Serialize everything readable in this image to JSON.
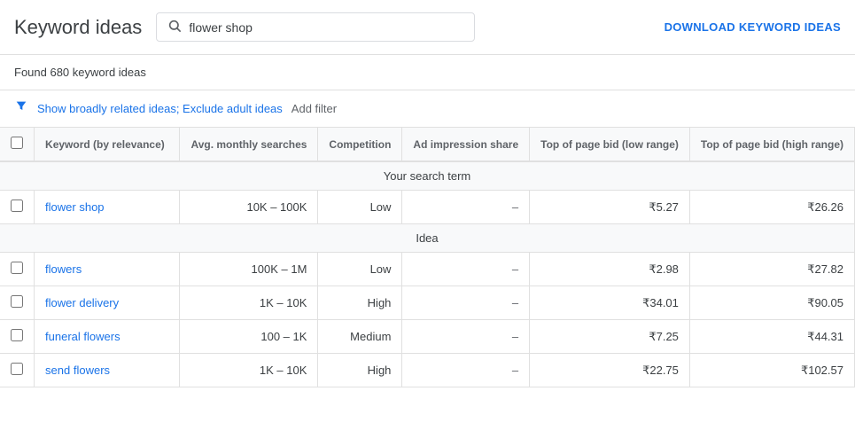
{
  "header": {
    "title": "Keyword ideas",
    "search_placeholder": "flower shop",
    "search_value": "flower shop",
    "download_label": "DOWNLOAD KEYWORD IDEAS"
  },
  "subheader": {
    "found_text": "Found 680 keyword ideas"
  },
  "filter_bar": {
    "filter_link": "Show broadly related ideas; Exclude adult ideas",
    "add_filter": "Add filter"
  },
  "table": {
    "columns": [
      {
        "id": "checkbox",
        "label": ""
      },
      {
        "id": "keyword",
        "label": "Keyword (by relevance)"
      },
      {
        "id": "avg_monthly",
        "label": "Avg. monthly searches"
      },
      {
        "id": "competition",
        "label": "Competition"
      },
      {
        "id": "ad_impression",
        "label": "Ad impression share"
      },
      {
        "id": "top_bid_low",
        "label": "Top of page bid (low range)"
      },
      {
        "id": "top_bid_high",
        "label": "Top of page bid (high range)"
      }
    ],
    "sections": [
      {
        "section_label": "Your search term",
        "rows": [
          {
            "keyword": "flower shop",
            "avg_monthly": "10K – 100K",
            "competition": "Low",
            "ad_impression": "–",
            "top_bid_low": "₹5.27",
            "top_bid_high": "₹26.26"
          }
        ]
      },
      {
        "section_label": "Idea",
        "rows": [
          {
            "keyword": "flowers",
            "avg_monthly": "100K – 1M",
            "competition": "Low",
            "ad_impression": "–",
            "top_bid_low": "₹2.98",
            "top_bid_high": "₹27.82"
          },
          {
            "keyword": "flower delivery",
            "avg_monthly": "1K – 10K",
            "competition": "High",
            "ad_impression": "–",
            "top_bid_low": "₹34.01",
            "top_bid_high": "₹90.05"
          },
          {
            "keyword": "funeral flowers",
            "avg_monthly": "100 – 1K",
            "competition": "Medium",
            "ad_impression": "–",
            "top_bid_low": "₹7.25",
            "top_bid_high": "₹44.31"
          },
          {
            "keyword": "send flowers",
            "avg_monthly": "1K – 10K",
            "competition": "High",
            "ad_impression": "–",
            "top_bid_low": "₹22.75",
            "top_bid_high": "₹102.57"
          }
        ]
      }
    ]
  }
}
